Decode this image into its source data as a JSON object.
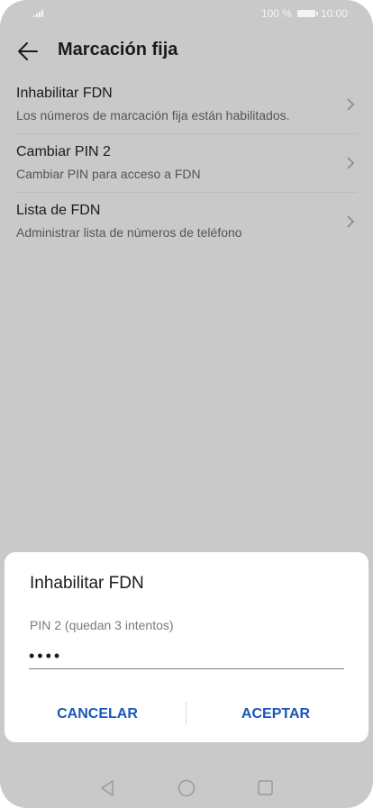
{
  "status_bar": {
    "battery": "100 %",
    "time": "10:00"
  },
  "header": {
    "title": "Marcación fija"
  },
  "settings_list": [
    {
      "title": "Inhabilitar FDN",
      "subtitle": "Los números de marcación fija están habilitados."
    },
    {
      "title": "Cambiar PIN 2",
      "subtitle": "Cambiar PIN para acceso a FDN"
    },
    {
      "title": "Lista de FDN",
      "subtitle": "Administrar lista de números de teléfono"
    }
  ],
  "dialog": {
    "title": "Inhabilitar FDN",
    "field_label": "PIN 2 (quedan 3 intentos)",
    "field_value": "••••",
    "cancel_label": "CANCELAR",
    "accept_label": "ACEPTAR"
  },
  "colors": {
    "accent": "#1a56b8",
    "scrim": "#c9c9c9",
    "dialog_bg": "#ffffff"
  }
}
